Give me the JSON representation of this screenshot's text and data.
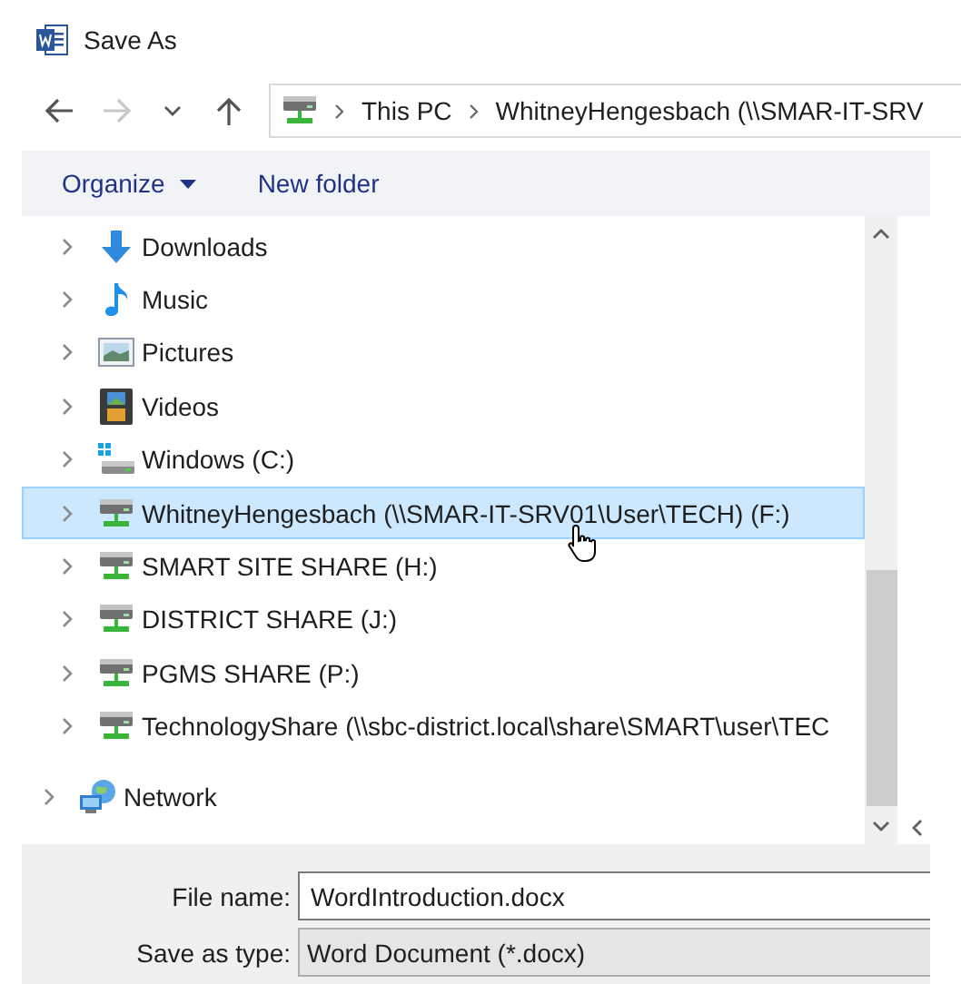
{
  "window": {
    "title": "Save As"
  },
  "nav": [
    {
      "kind": "back",
      "disabled": false
    },
    {
      "kind": "forward",
      "disabled": true
    },
    {
      "kind": "recent",
      "disabled": false
    },
    {
      "kind": "up",
      "disabled": false
    }
  ],
  "address": {
    "crumbs": [
      "This PC",
      "WhitneyHengesbach (\\\\SMAR-IT-SRV"
    ]
  },
  "toolbar": {
    "organize": "Organize",
    "new_folder": "New folder"
  },
  "tree": [
    {
      "kind": "group",
      "children": [
        {
          "kind": "downloads",
          "label": "Downloads",
          "selected": false
        },
        {
          "kind": "music",
          "label": "Music",
          "selected": false
        },
        {
          "kind": "pictures",
          "label": "Pictures",
          "selected": false
        },
        {
          "kind": "videos",
          "label": "Videos",
          "selected": false
        },
        {
          "kind": "windows-drive",
          "label": "Windows (C:)",
          "selected": false
        },
        {
          "kind": "network-drive",
          "label": "WhitneyHengesbach (\\\\SMAR-IT-SRV01\\User\\TECH) (F:)",
          "selected": true
        },
        {
          "kind": "network-drive",
          "label": "SMART SITE SHARE (H:)",
          "selected": false
        },
        {
          "kind": "network-drive",
          "label": "DISTRICT SHARE (J:)",
          "selected": false
        },
        {
          "kind": "network-drive",
          "label": "PGMS SHARE (P:)",
          "selected": false
        },
        {
          "kind": "network-drive",
          "label": "TechnologyShare (\\\\sbc-district.local\\share\\SMART\\user\\TEC",
          "selected": false
        }
      ]
    },
    {
      "kind": "network",
      "label": "Network",
      "selected": false
    }
  ],
  "fields": [
    {
      "label": "File name:",
      "value": "WordIntroduction.docx",
      "kind": "input"
    },
    {
      "label": "Save as type:",
      "value": "Word Document (*.docx)",
      "kind": "select"
    }
  ]
}
